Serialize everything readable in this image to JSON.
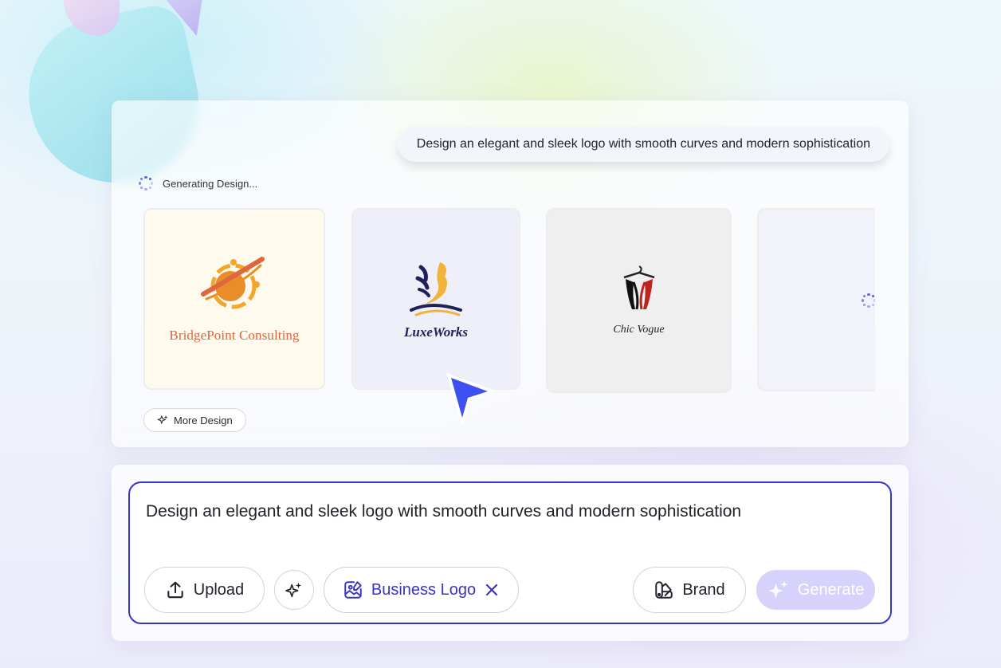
{
  "prompt_bubble": "Design an elegant and sleek logo with smooth curves and modern sophistication",
  "status": {
    "text": "Generating Design..."
  },
  "designs": [
    {
      "name": "BridgePoint Consulting",
      "bg": "#fefaee",
      "color": "#e0663f"
    },
    {
      "name": "LuxeWorks",
      "bg": "#efeffa",
      "color": "#1f2158"
    },
    {
      "name": "Chic Vogue",
      "bg": "#efeff0",
      "color": "#222222"
    },
    {
      "name": "",
      "bg": "#f1f2fa",
      "loading": true
    }
  ],
  "more_design_label": "More Design",
  "composer": {
    "text": "Design an elegant and sleek logo with smooth curves and modern sophistication",
    "upload_label": "Upload",
    "logo_type_label": "Business Logo",
    "brand_label": "Brand",
    "generate_label": "Generate"
  },
  "colors": {
    "accent": "#3b33c4",
    "cursor": "#3d50f2",
    "generate_bg": "#d6d2fb"
  },
  "icons": [
    "sparkles-icon",
    "upload-icon",
    "image-edit-icon",
    "close-icon",
    "brand-palette-icon",
    "spinner-icon",
    "cursor-arrow-icon"
  ]
}
